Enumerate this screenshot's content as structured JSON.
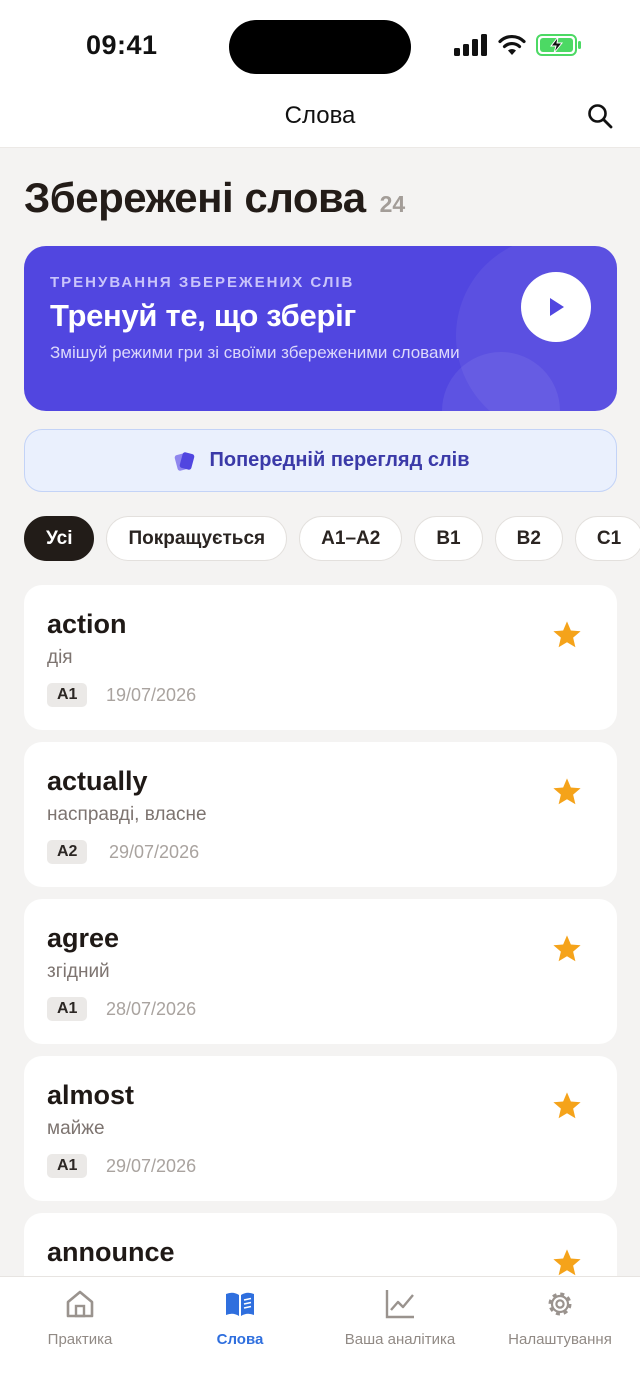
{
  "status_bar": {
    "time": "09:41"
  },
  "nav": {
    "title": "Слова"
  },
  "header": {
    "title": "Збережені слова",
    "count": "24"
  },
  "training_card": {
    "eyebrow": "ТРЕНУВАННЯ ЗБЕРЕЖЕНИХ СЛІВ",
    "title": "Тренуй те, що зберіг",
    "subtitle": "Змішуй режими гри зі своїми збереженими словами"
  },
  "preview": {
    "label": "Попередній перегляд слів"
  },
  "filters": [
    "Усі",
    "Покращується",
    "A1–A2",
    "B1",
    "B2",
    "C1"
  ],
  "words": [
    {
      "word": "action",
      "translation": "дія",
      "level": "A1",
      "date": "19/07/2026"
    },
    {
      "word": "actually",
      "translation": "насправді, власне",
      "level": "A2",
      "date": "29/07/2026"
    },
    {
      "word": "agree",
      "translation": "згідний",
      "level": "A1",
      "date": "28/07/2026"
    },
    {
      "word": "almost",
      "translation": "майже",
      "level": "A1",
      "date": "29/07/2026"
    },
    {
      "word": "announce",
      "translation": "",
      "level": "",
      "date": ""
    }
  ],
  "tabs": [
    {
      "label": "Практика",
      "icon": "home-icon"
    },
    {
      "label": "Слова",
      "icon": "book-icon"
    },
    {
      "label": "Ваша аналітика",
      "icon": "chart-icon"
    },
    {
      "label": "Налаштування",
      "icon": "gear-icon"
    }
  ],
  "colors": {
    "accent": "#5146e0",
    "tab_active": "#2f6fde",
    "star": "#f5a31a"
  }
}
